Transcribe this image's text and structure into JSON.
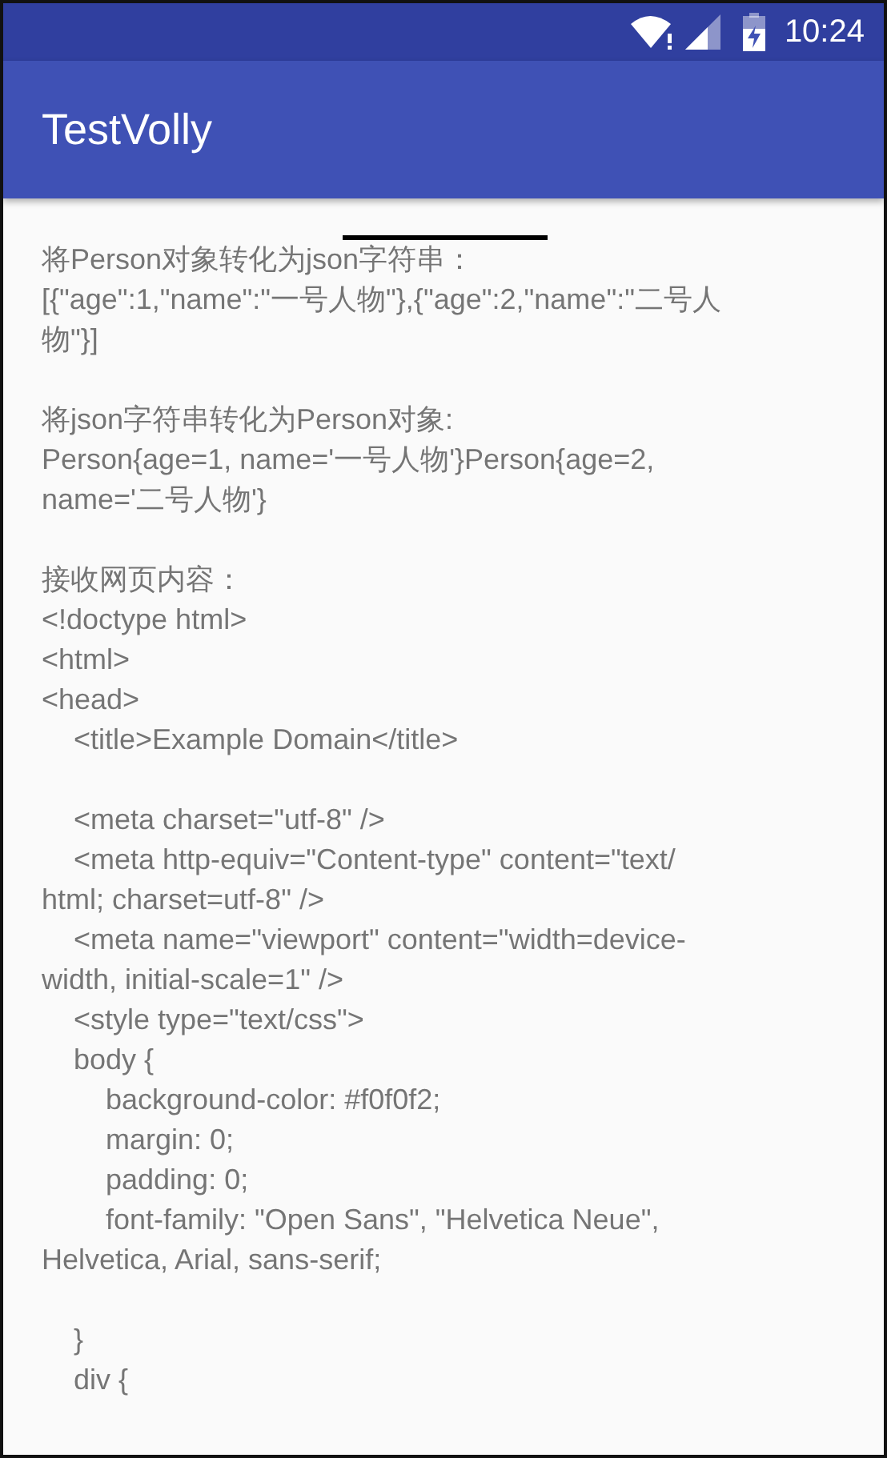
{
  "status_bar": {
    "time": "10:24"
  },
  "toolbar": {
    "title": "TestVolly"
  },
  "content": {
    "blocks": [
      [
        "将Person对象转化为json字符串：",
        "[{\"age\":1,\"name\":\"一号人物\"},{\"age\":2,\"name\":\"二号人",
        "物\"}]"
      ],
      [
        "将json字符串转化为Person对象:",
        "Person{age=1, name='一号人物'}Person{age=2,",
        "name='二号人物'}"
      ],
      [
        "接收网页内容：",
        "<!doctype html>",
        "<html>",
        "<head>",
        "    <title>Example Domain</title>"
      ],
      [
        "    <meta charset=\"utf-8\" />",
        "    <meta http-equiv=\"Content-type\" content=\"text/",
        "html; charset=utf-8\" />",
        "    <meta name=\"viewport\" content=\"width=device-",
        "width, initial-scale=1\" />",
        "    <style type=\"text/css\">",
        "    body {",
        "        background-color: #f0f0f2;",
        "        margin: 0;",
        "        padding: 0;",
        "        font-family: \"Open Sans\", \"Helvetica Neue\",",
        "Helvetica, Arial, sans-serif;"
      ],
      [
        "    }",
        "    div {"
      ]
    ]
  }
}
